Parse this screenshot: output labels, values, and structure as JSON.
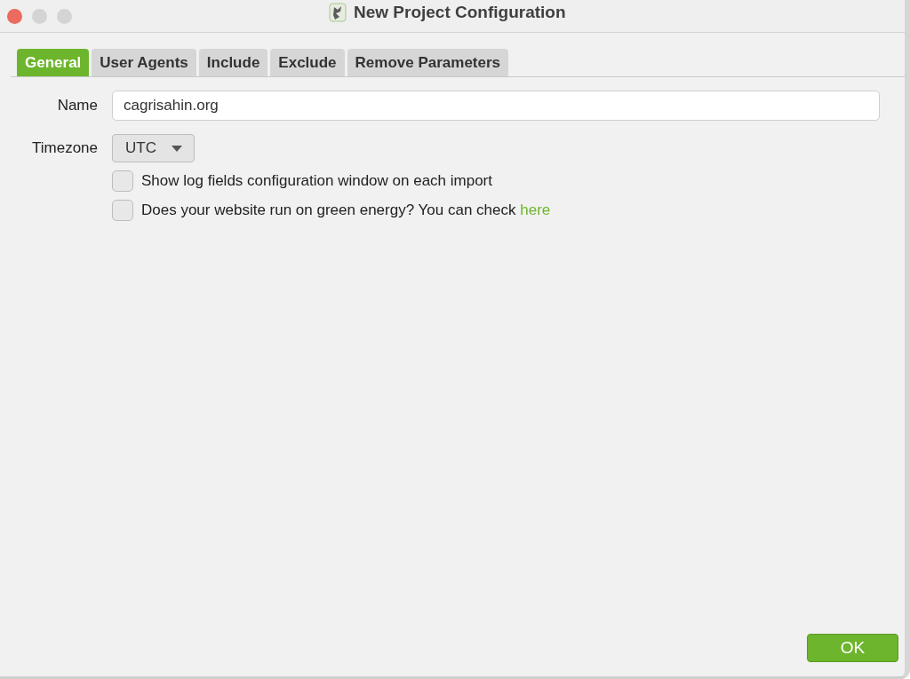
{
  "window": {
    "title": "New Project Configuration"
  },
  "tabs": [
    {
      "label": "General",
      "selected": true
    },
    {
      "label": "User Agents",
      "selected": false
    },
    {
      "label": "Include",
      "selected": false
    },
    {
      "label": "Exclude",
      "selected": false
    },
    {
      "label": "Remove Parameters",
      "selected": false
    }
  ],
  "name_field": {
    "label": "Name",
    "value": "cagrisahin.org"
  },
  "timezone": {
    "label": "Timezone",
    "value": "UTC"
  },
  "options": [
    {
      "text": "Show log fields configuration window on each import",
      "checked": false
    },
    {
      "text": "Does your website run on green energy? You can check ",
      "link": "here",
      "checked": false
    }
  ],
  "buttons": [
    "OK"
  ]
}
